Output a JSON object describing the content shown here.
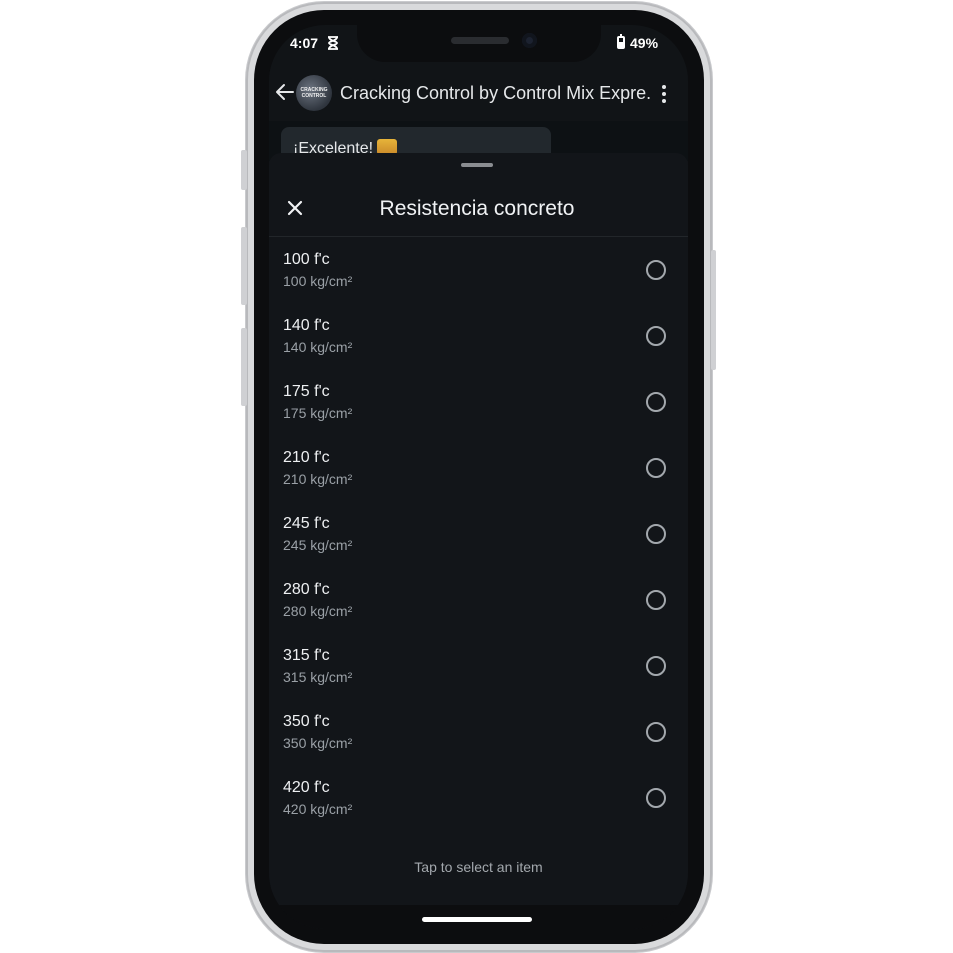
{
  "status": {
    "time": "4:07",
    "battery": "49%"
  },
  "app_bar": {
    "avatar_text": "CRACKING CONTROL",
    "title": "Cracking Control by Control Mix Expre..."
  },
  "chat": {
    "bubble_text": "¡Excelente!"
  },
  "sheet": {
    "title": "Resistencia concreto",
    "footer": "Tap to select an item",
    "options": [
      {
        "label": "100 f'c",
        "value": "100 kg/cm²"
      },
      {
        "label": "140 f'c",
        "value": "140 kg/cm²"
      },
      {
        "label": "175 f'c",
        "value": "175 kg/cm²"
      },
      {
        "label": "210 f'c",
        "value": "210 kg/cm²"
      },
      {
        "label": "245 f'c",
        "value": "245 kg/cm²"
      },
      {
        "label": "280 f'c",
        "value": "280 kg/cm²"
      },
      {
        "label": "315 f'c",
        "value": "315 kg/cm²"
      },
      {
        "label": "350 f'c",
        "value": "350 kg/cm²"
      },
      {
        "label": "420 f'c",
        "value": "420 kg/cm²"
      }
    ]
  },
  "icons": {
    "back": "back-arrow-icon",
    "menu": "kebab-menu-icon",
    "close": "close-icon",
    "radio": "radio-unselected-icon",
    "status": "hourglass-icon"
  }
}
